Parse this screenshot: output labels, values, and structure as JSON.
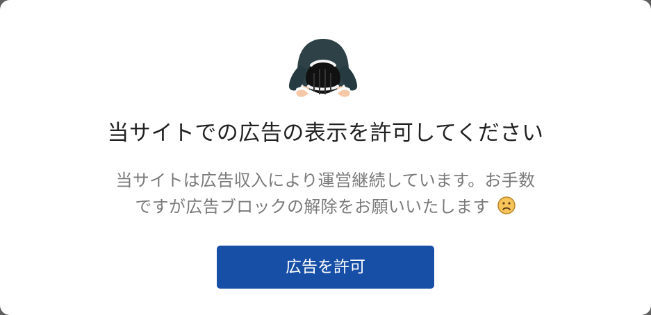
{
  "modal": {
    "headline": "当サイトでの広告の表示を許可してください",
    "message_line_1": "当サイトは広告収入により運営継続しています。お手数",
    "message_line_2": "ですが広告ブロックの解除をお願いいたします",
    "message_emoji": "slightly-frowning-face-icon",
    "allow_button_label": "広告を許可"
  },
  "colors": {
    "button_background": "#174ea6",
    "headline_text": "#222222",
    "message_text": "#7a7a7a"
  }
}
